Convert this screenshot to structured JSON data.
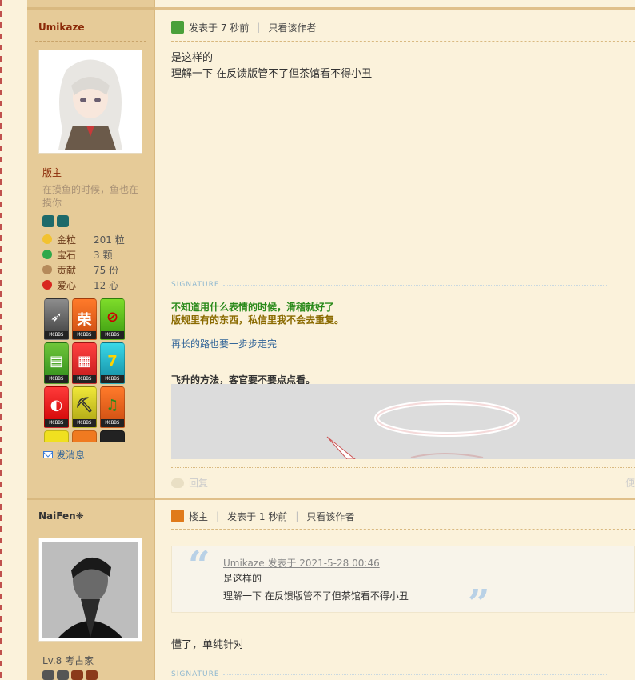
{
  "posts": [
    {
      "username": "Umikaze",
      "group": "版主",
      "motto": "在摸鱼的时候，鱼也在摸你",
      "stats": [
        {
          "label": "金粒",
          "value": "201 粒",
          "icon": "gold-nugget-icon",
          "color": "#f2c230"
        },
        {
          "label": "宝石",
          "value": "3 颗",
          "icon": "emerald-icon",
          "color": "#2ea84a"
        },
        {
          "label": "贡献",
          "value": "75 份",
          "icon": "cookie-icon",
          "color": "#b58a5a"
        },
        {
          "label": "爱心",
          "value": "12 心",
          "icon": "apple-heart-icon",
          "color": "#d8261f"
        }
      ],
      "medals_caption": "MCBBS",
      "send_message": "发消息",
      "posted": "发表于 7 秒前",
      "only_author": "只看该作者",
      "body_lines": [
        "是这样的",
        "理解一下 在反馈版管不了但茶馆看不得小丑"
      ],
      "signature_label": "SIGNATURE",
      "signature_lines": [
        "不知道用什么表情的时候，滑稽就好了",
        "版规里有的东西，私信里我不会去重复。"
      ],
      "signature_blue": "再长的路也要一步步走完",
      "signature_title": "飞升的方法，客官要不要点点看。",
      "reply": "回复",
      "reply_right": "便"
    },
    {
      "username": "NaiFen❋",
      "level": "Lv.8 考古家",
      "owner_label": "楼主",
      "posted": "发表于 1 秒前",
      "only_author": "只看该作者",
      "quote_head": "Umikaze 发表于 2021-5-28 00:46",
      "quote_lines": [
        "是这样的",
        "理解一下 在反馈版管不了但茶馆看不得小丑"
      ],
      "body": "懂了，单纯针对",
      "signature_label": "SIGNATURE"
    }
  ],
  "colors": {
    "username": "#8b2a08",
    "sidebar": "#e6cb98",
    "page": "#fbf2db",
    "link": "#336699",
    "sig_green": "#2a8a1a",
    "sig_olive": "#8a6a00"
  }
}
